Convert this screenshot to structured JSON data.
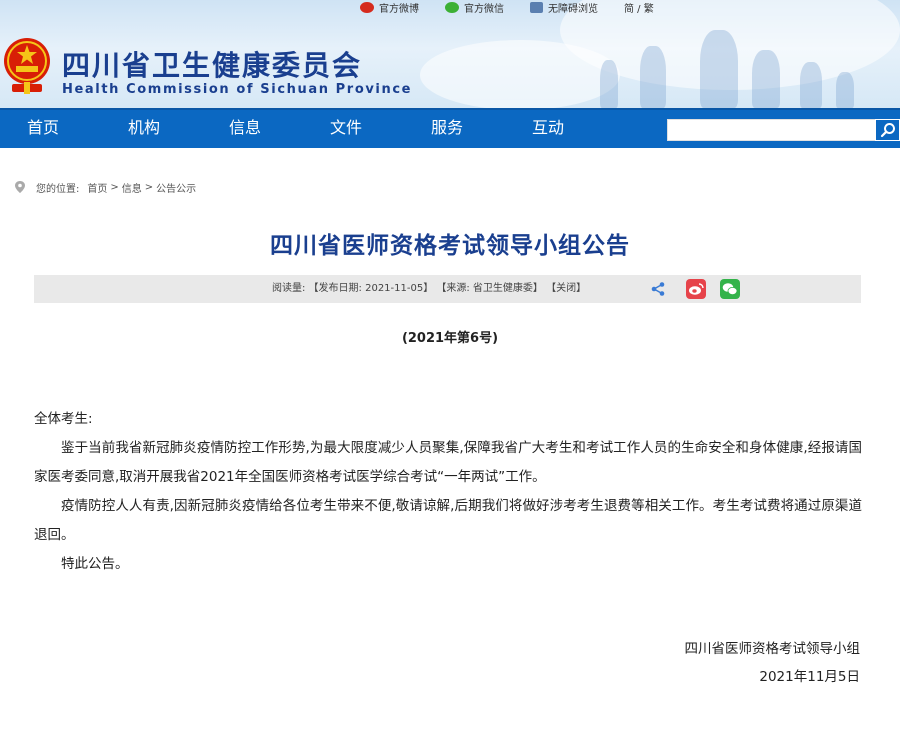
{
  "topbar": {
    "weibo_label": "官方微博",
    "wechat_label": "官方微信",
    "access_label": "无障碍浏览",
    "lang_label": "简 / 繁"
  },
  "header": {
    "org_name_cn": "四川省卫生健康委员会",
    "org_name_en": "Health Commission of Sichuan Province"
  },
  "nav": {
    "items": [
      {
        "label": "首页"
      },
      {
        "label": "机构"
      },
      {
        "label": "信息"
      },
      {
        "label": "文件"
      },
      {
        "label": "服务"
      },
      {
        "label": "互动"
      }
    ],
    "search_placeholder": ""
  },
  "breadcrumb": {
    "prefix": "您的位置:",
    "items": [
      "首页",
      "信息",
      "公告公示"
    ],
    "separator": ">"
  },
  "article": {
    "title": "四川省医师资格考试领导小组公告",
    "info_line": "阅读量: 【发布日期: 2021-11-05】 【来源: 省卫生健康委】 【关闭】",
    "doc_number": "(2021年第6号)",
    "salutation": "全体考生:",
    "paragraphs": [
      "鉴于当前我省新冠肺炎疫情防控工作形势,为最大限度减少人员聚集,保障我省广大考生和考试工作人员的生命安全和身体健康,经报请国家医考委同意,取消开展我省2021年全国医师资格考试医学综合考试“一年两试”工作。",
      "疫情防控人人有责,因新冠肺炎疫情给各位考生带来不便,敬请谅解,后期我们将做好涉考考生退费等相关工作。考生考试费将通过原渠道退回。",
      "特此公告。"
    ],
    "signature": "四川省医师资格考试领导小组",
    "date": "2021年11月5日"
  },
  "colors": {
    "nav_bg": "#0b68c2",
    "title": "#1a3f8f",
    "weibo": "#e6434a",
    "wechat": "#33b34a"
  }
}
